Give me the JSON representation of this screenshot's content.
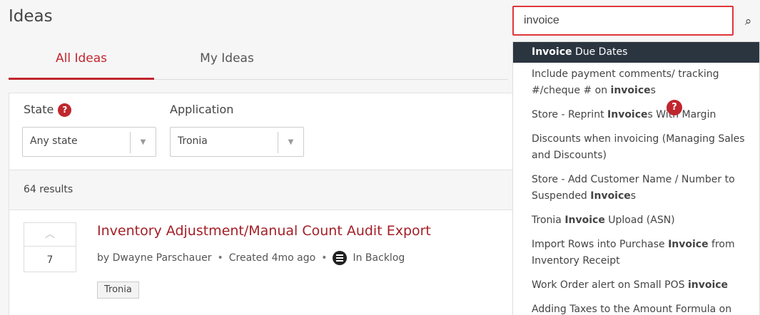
{
  "page": {
    "title": "Ideas"
  },
  "tabs": [
    {
      "label": "All Ideas",
      "active": true
    },
    {
      "label": "My Ideas",
      "active": false
    }
  ],
  "filters": {
    "state": {
      "label": "State",
      "value": "Any state",
      "help": "?"
    },
    "application": {
      "label": "Application",
      "value": "Tronia"
    }
  },
  "results": {
    "count_text": "64 results"
  },
  "idea": {
    "votes": "7",
    "title": "Inventory Adjustment/Manual Count Audit Export",
    "author": "by Dwayne Parschauer",
    "created": "Created 4mo ago",
    "status": "In Backlog",
    "separator": "•",
    "tag": "Tronia"
  },
  "search": {
    "value": "invoice",
    "suggestions": [
      {
        "parts": [
          {
            "t": "Invoice",
            "b": true
          },
          {
            "t": " Due Dates",
            "b": false
          }
        ]
      },
      {
        "parts": [
          {
            "t": "Include payment comments/ tracking #/cheque # on ",
            "b": false
          },
          {
            "t": "invoice",
            "b": true
          },
          {
            "t": "s",
            "b": false
          }
        ]
      },
      {
        "parts": [
          {
            "t": "Store - Reprint ",
            "b": false
          },
          {
            "t": "Invoice",
            "b": true
          },
          {
            "t": "s With Margin",
            "b": false
          }
        ]
      },
      {
        "parts": [
          {
            "t": "Discounts when invoicing (Managing Sales and Discounts)",
            "b": false
          }
        ]
      },
      {
        "parts": [
          {
            "t": "Store - Add Customer Name / Number to Suspended ",
            "b": false
          },
          {
            "t": "Invoice",
            "b": true
          },
          {
            "t": "s",
            "b": false
          }
        ]
      },
      {
        "parts": [
          {
            "t": "Tronia ",
            "b": false
          },
          {
            "t": "Invoice",
            "b": true
          },
          {
            "t": " Upload (ASN)",
            "b": false
          }
        ]
      },
      {
        "parts": [
          {
            "t": "Import Rows into Purchase ",
            "b": false
          },
          {
            "t": "Invoice",
            "b": true
          },
          {
            "t": " from Inventory Receipt",
            "b": false
          }
        ]
      },
      {
        "parts": [
          {
            "t": "Work Order alert on Small POS ",
            "b": false
          },
          {
            "t": "invoice",
            "b": true
          }
        ]
      },
      {
        "parts": [
          {
            "t": "Adding Taxes to the Amount Formula on",
            "b": false
          }
        ]
      }
    ],
    "overlay_help": "?"
  },
  "colors": {
    "accent": "#c0262d",
    "dropdown_active": "#2b3540"
  },
  "icons": {
    "search": "search-icon",
    "status": "backlog-icon",
    "vote": "chevron-up-icon",
    "select_arrow": "chevron-down-icon"
  }
}
